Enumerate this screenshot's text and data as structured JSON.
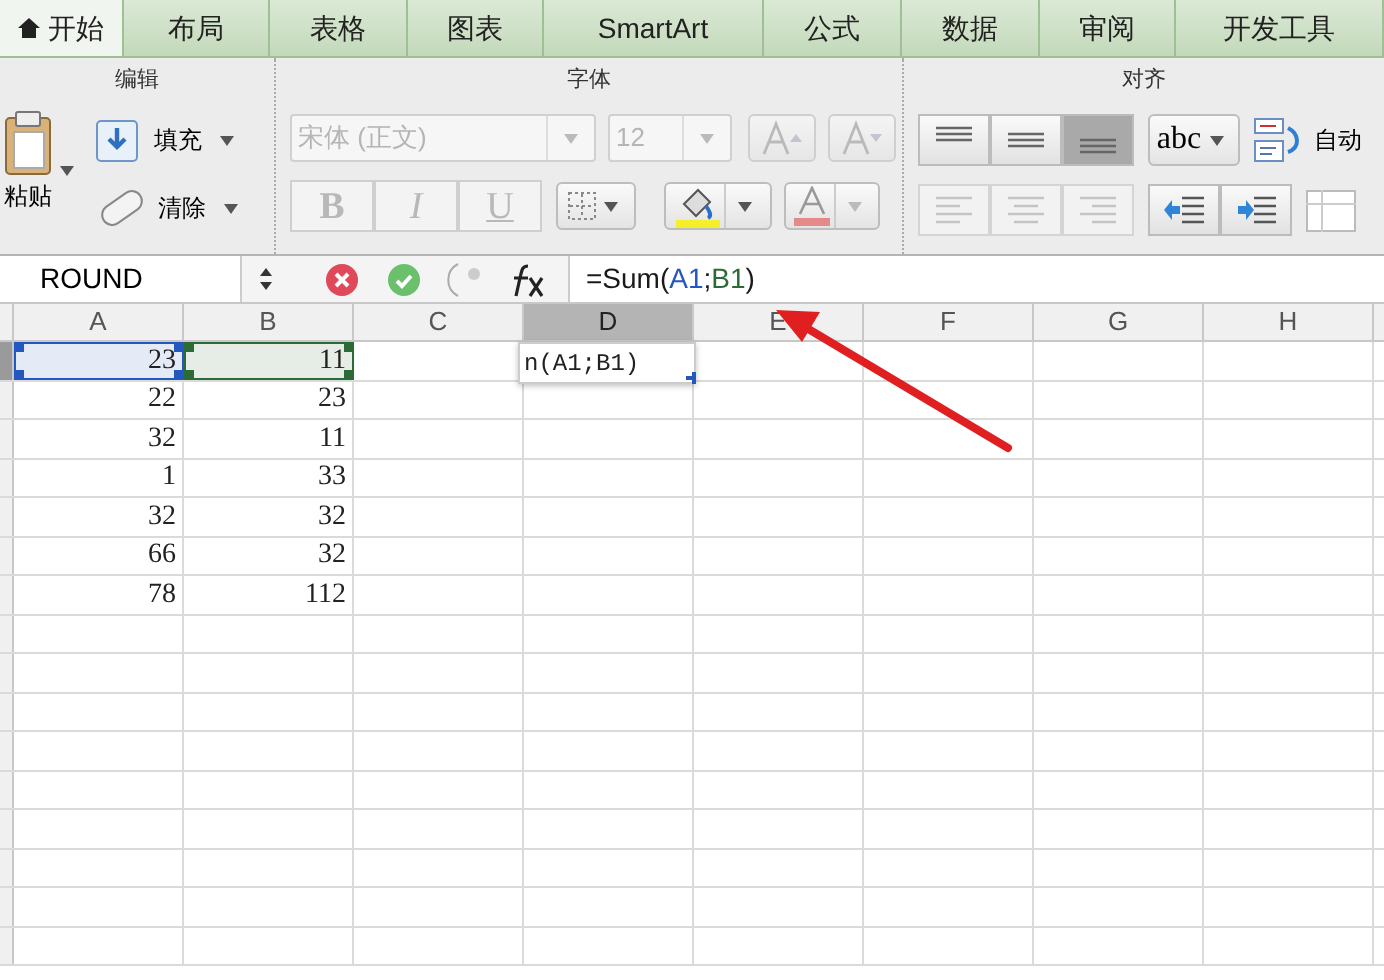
{
  "tabs": [
    {
      "label": "开始",
      "kind": "home",
      "selected": true
    },
    {
      "label": "布局",
      "selected": false
    },
    {
      "label": "表格",
      "selected": false
    },
    {
      "label": "图表",
      "selected": false
    },
    {
      "label": "SmartArt",
      "selected": false
    },
    {
      "label": "公式",
      "selected": false
    },
    {
      "label": "数据",
      "selected": false
    },
    {
      "label": "审阅",
      "selected": false
    },
    {
      "label": "开发工具",
      "selected": false
    }
  ],
  "ribbon": {
    "groups": [
      {
        "title": "编辑"
      },
      {
        "title": "字体"
      },
      {
        "title": "对齐"
      }
    ],
    "paste_label": "粘贴",
    "fill_label": "填充",
    "clear_label": "清除",
    "font_name": {
      "value": "宋体 (正文)",
      "disabled": true
    },
    "font_size": {
      "value": "12",
      "disabled": true
    },
    "style_buttons": [
      {
        "label": "B",
        "disabled": true
      },
      {
        "label": "I",
        "disabled": true
      },
      {
        "label": "U",
        "disabled": true
      }
    ],
    "alignment_buttons": [
      {
        "selected": false
      },
      {
        "selected": false
      },
      {
        "selected": true
      }
    ],
    "orientation_label": "abc",
    "wrap_label": "自动"
  },
  "formula_bar": {
    "name_box": "ROUND",
    "formula": [
      {
        "text": "=Sum(",
        "color": "#1a1a1a"
      },
      {
        "text": "A1",
        "color": "#2458c0"
      },
      {
        "text": ";",
        "color": "#1a1a1a"
      },
      {
        "text": "B1",
        "color": "#2b6b35"
      },
      {
        "text": ")",
        "color": "#1a1a1a"
      }
    ]
  },
  "sheet": {
    "columns": [
      {
        "label": "A",
        "selected": false
      },
      {
        "label": "B",
        "selected": false
      },
      {
        "label": "C",
        "selected": false
      },
      {
        "label": "D",
        "selected": true
      },
      {
        "label": "E",
        "selected": false
      },
      {
        "label": "F",
        "selected": false
      },
      {
        "label": "G",
        "selected": false
      },
      {
        "label": "H",
        "selected": false
      }
    ],
    "rows": [
      {
        "selected": true,
        "cells": [
          {
            "text": "23",
            "color": "#2458c0"
          },
          {
            "text": "11",
            "color": "#2b6b35"
          }
        ]
      },
      {
        "selected": false,
        "cells": [
          {
            "text": "22"
          },
          {
            "text": "23"
          }
        ]
      },
      {
        "selected": false,
        "cells": [
          {
            "text": "32"
          },
          {
            "text": "11"
          }
        ]
      },
      {
        "selected": false,
        "cells": [
          {
            "text": "1"
          },
          {
            "text": "33"
          }
        ]
      },
      {
        "selected": false,
        "cells": [
          {
            "text": "32"
          },
          {
            "text": "32"
          }
        ]
      },
      {
        "selected": false,
        "cells": [
          {
            "text": "66"
          },
          {
            "text": "32"
          }
        ]
      },
      {
        "selected": false,
        "cells": [
          {
            "text": "78"
          },
          {
            "text": "112"
          }
        ]
      }
    ],
    "tooltip": "n(A1;B1)"
  }
}
